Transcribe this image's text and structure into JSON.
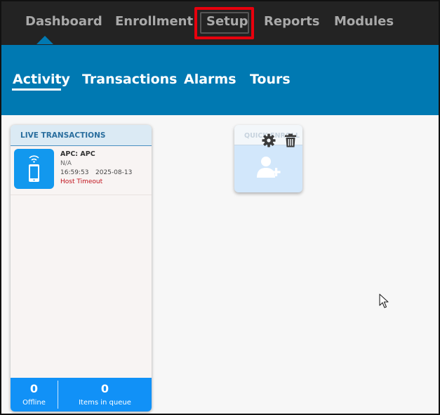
{
  "topnav": {
    "items": [
      {
        "label": "Dashboard"
      },
      {
        "label": "Enrollment"
      },
      {
        "label": "Setup"
      },
      {
        "label": "Reports"
      },
      {
        "label": "Modules"
      }
    ]
  },
  "subnav": {
    "items": [
      {
        "label": "Activity"
      },
      {
        "label": "Transactions"
      },
      {
        "label": "Alarms"
      },
      {
        "label": "Tours"
      }
    ]
  },
  "live_panel": {
    "title": "LIVE TRANSACTIONS",
    "transactions": [
      {
        "title": "APC: APC",
        "sub": "N/A",
        "time": "16:59:53",
        "date": "2025-08-13",
        "status": "Host Timeout",
        "icon": "mobile-phone-icon"
      }
    ],
    "footer": {
      "offline_count": "0",
      "offline_label": "Offline",
      "queue_count": "0",
      "queue_label": "Items in queue"
    }
  },
  "quick_tile": {
    "title": "QUICK ENROLL",
    "icons": [
      "gear-icon",
      "trash-icon",
      "add-user-icon"
    ]
  },
  "colors": {
    "topnav_bg": "#232323",
    "subnav_bg": "#0079b2",
    "accent_blue": "#1191f7",
    "highlight_red": "#e8000d",
    "status_error": "#c0101a"
  }
}
